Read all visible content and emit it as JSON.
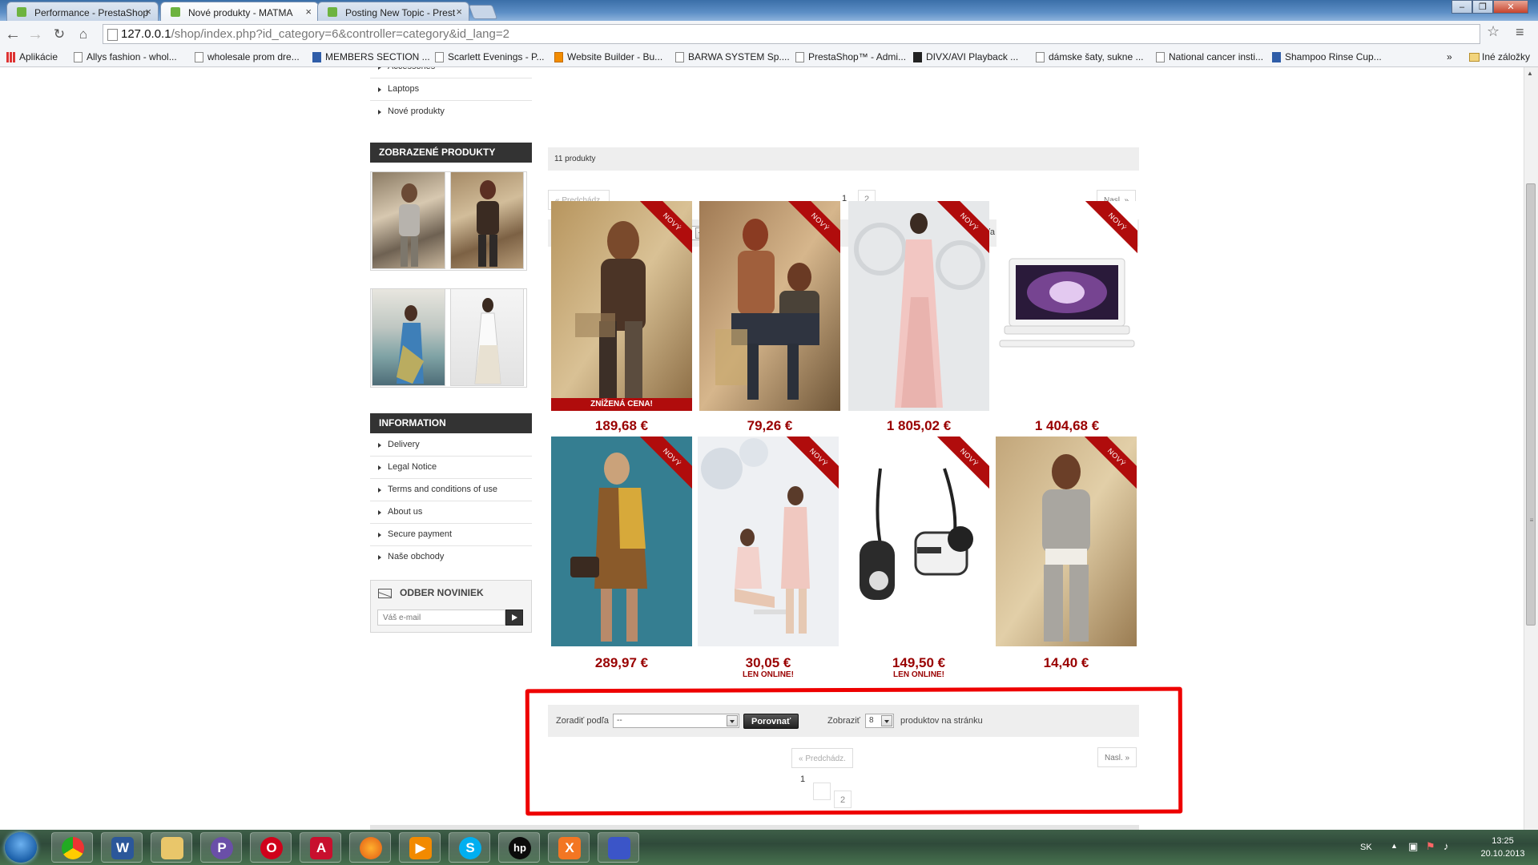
{
  "browser": {
    "tabs": [
      {
        "title": "Performance - PrestaShop",
        "active": false
      },
      {
        "title": "Nové produkty - MATMA",
        "active": true
      },
      {
        "title": "Posting New Topic - Prest",
        "active": false
      }
    ],
    "url_host": "127.0.0.1",
    "url_rest": "/shop/index.php?id_category=6&controller=category&id_lang=2",
    "bookmarks": [
      {
        "label": "Aplikácie",
        "icon": "apps-icon"
      },
      {
        "label": "Allys fashion - whol...",
        "icon": "page-icon"
      },
      {
        "label": "wholesale prom dre...",
        "icon": "page-icon"
      },
      {
        "label": "MEMBERS SECTION ...",
        "icon": "site-icon"
      },
      {
        "label": "Scarlett Evenings - P...",
        "icon": "page-icon"
      },
      {
        "label": "Website Builder - Bu...",
        "icon": "builder-icon"
      },
      {
        "label": "BARWA SYSTEM Sp....",
        "icon": "page-icon"
      },
      {
        "label": "PrestaShop™ - Admi...",
        "icon": "page-icon"
      },
      {
        "label": "DIVX/AVI Playback ...",
        "icon": "divx-icon"
      },
      {
        "label": "dámske šaty, sukne ...",
        "icon": "page-icon"
      },
      {
        "label": "National cancer insti...",
        "icon": "page-icon"
      },
      {
        "label": "Shampoo Rinse Cup...",
        "icon": "site-icon"
      }
    ],
    "bookmarks_overflow": "»",
    "other_bookmarks": "Iné záložky"
  },
  "sidebar": {
    "categories": [
      "Accessories",
      "Laptops",
      "Nové produkty"
    ],
    "viewed_title": "ZOBRAZENÉ PRODUKTY",
    "info_title": "INFORMATION",
    "info_links": [
      "Delivery",
      "Legal Notice",
      "Terms and conditions of use",
      "About us",
      "Secure payment",
      "Naše obchody"
    ],
    "newsletter_title": "ODBER NOVINIEK",
    "newsletter_placeholder": "Váš e-mail"
  },
  "listing": {
    "count": "11 produkty",
    "prev": "« Predchádz.",
    "next": "Nasl. »",
    "page1": "1",
    "page2": "2",
    "compare": "Porovnať",
    "show_label": "Zobraziť",
    "per_page_value": "8",
    "per_page_suffix": "produktov na stránku",
    "sort_label": "Zoradiť podľa",
    "sort_value": "--"
  },
  "products": [
    {
      "price": "189,68 €",
      "badge": "NOVÝ",
      "sale": "ZNÍŽENÁ CENA!",
      "online": ""
    },
    {
      "price": "79,26 €",
      "badge": "NOVÝ",
      "sale": "",
      "online": ""
    },
    {
      "price": "1 805,02 €",
      "badge": "NOVÝ",
      "sale": "",
      "online": ""
    },
    {
      "price": "1 404,68 €",
      "badge": "NOVÝ",
      "sale": "",
      "online": ""
    },
    {
      "price": "289,97 €",
      "badge": "NOVÝ",
      "sale": "",
      "online": ""
    },
    {
      "price": "30,05 €",
      "badge": "NOVÝ",
      "sale": "",
      "online": "LEN ONLINE!"
    },
    {
      "price": "149,50 €",
      "badge": "NOVÝ",
      "sale": "",
      "online": "LEN ONLINE!"
    },
    {
      "price": "14,40 €",
      "badge": "NOVÝ",
      "sale": "",
      "online": ""
    }
  ],
  "taskbar": {
    "lang": "SK",
    "time": "13:25",
    "date": "20.10.2013",
    "apps": [
      "chrome-icon",
      "word-icon",
      "explorer-icon",
      "pidgin-icon",
      "opera-icon",
      "acrobat-icon",
      "firefox-icon",
      "media-player-icon",
      "skype-icon",
      "hp-icon",
      "xampp-icon",
      "save-icon"
    ]
  },
  "colors": {
    "price": "#990000",
    "ribbon": "#b00c0c",
    "highlight": "#ee0000",
    "block_header": "#333333"
  }
}
